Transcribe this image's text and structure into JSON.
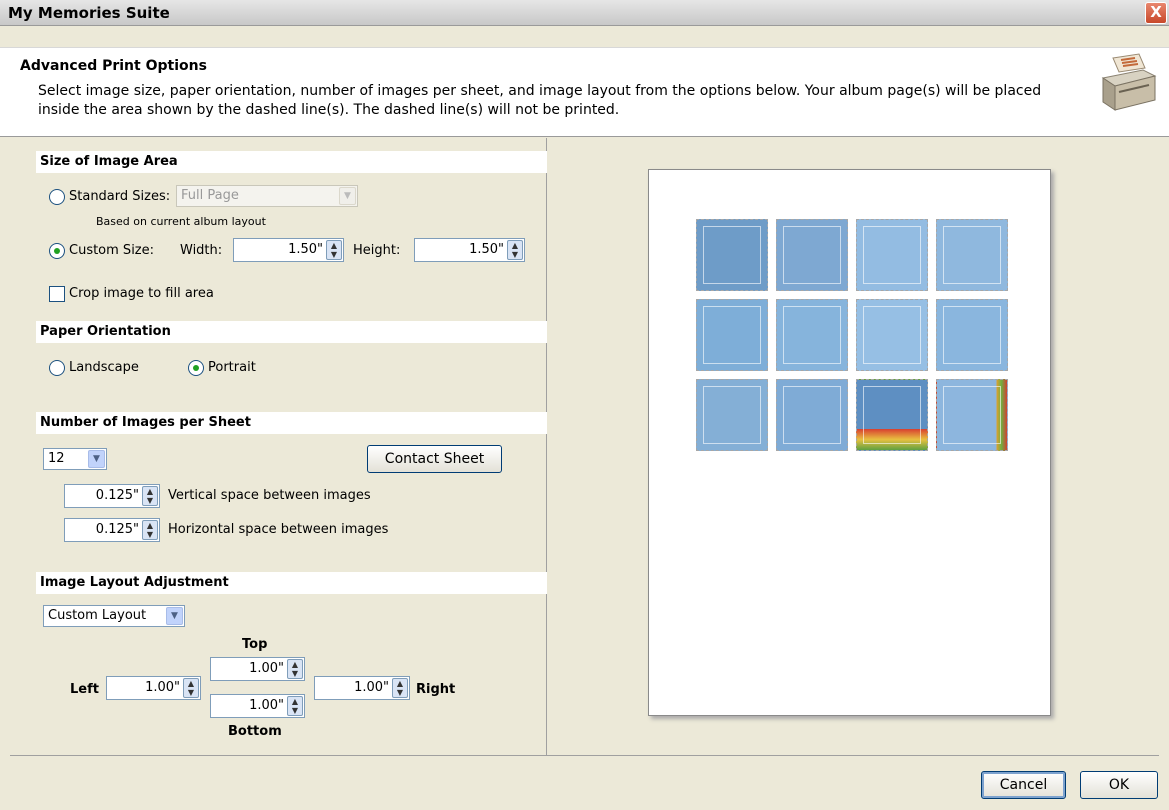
{
  "window": {
    "title": "My Memories Suite",
    "close_label": "X"
  },
  "header": {
    "title": "Advanced Print Options",
    "description": "Select image size, paper orientation, number of images per sheet, and image layout from the options below. Your album page(s) will be placed inside the area shown by the dashed line(s). The dashed line(s) will not be printed."
  },
  "size": {
    "header": "Size of Image Area",
    "standard_label": "Standard Sizes:",
    "standard_value": "Full Page",
    "standard_note": "Based on current album layout",
    "custom_label": "Custom Size:",
    "width_label": "Width:",
    "width_value": "1.50\"",
    "height_label": "Height:",
    "height_value": "1.50\"",
    "crop_label": "Crop image to fill area",
    "selected": "custom"
  },
  "orientation": {
    "header": "Paper Orientation",
    "landscape_label": "Landscape",
    "portrait_label": "Portrait",
    "selected": "portrait"
  },
  "per_sheet": {
    "header": "Number of Images per Sheet",
    "count_value": "12",
    "contact_sheet_label": "Contact Sheet",
    "vertical_value": "0.125\"",
    "vertical_label": "Vertical space between images",
    "horizontal_value": "0.125\"",
    "horizontal_label": "Horizontal space between images"
  },
  "layout": {
    "header": "Image Layout Adjustment",
    "mode_value": "Custom Layout",
    "top_label": "Top",
    "top_value": "1.00\"",
    "left_label": "Left",
    "left_value": "1.00\"",
    "right_label": "Right",
    "right_value": "1.00\"",
    "bottom_label": "Bottom",
    "bottom_value": "1.00\""
  },
  "footer": {
    "cancel_label": "Cancel",
    "ok_label": "OK"
  },
  "colors": {
    "accent_blue": "#7FAEDC",
    "radio_selected": "#21A121"
  }
}
